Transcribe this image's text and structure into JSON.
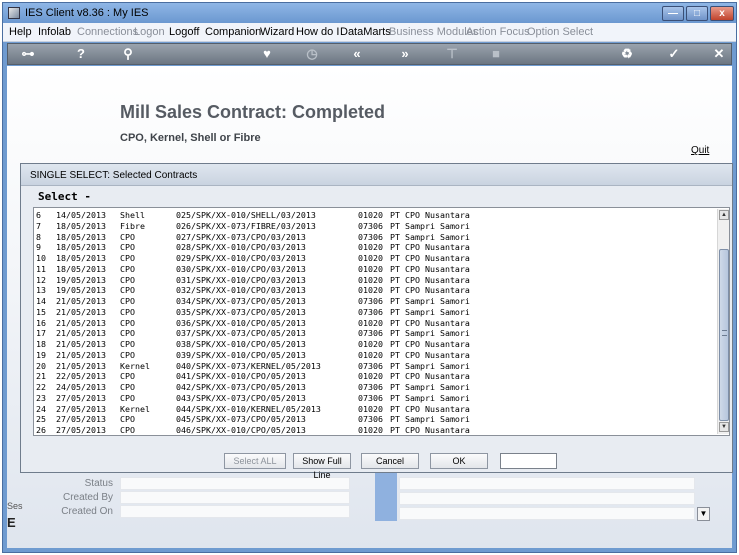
{
  "window": {
    "title": "IES Client v8.36 : My IES"
  },
  "window_controls": {
    "minimize": "—",
    "maximize": "□",
    "close": "x"
  },
  "menu": {
    "items": [
      {
        "label": "Help",
        "enabled": true
      },
      {
        "label": "Infolab",
        "enabled": true
      },
      {
        "label": "Connections",
        "enabled": false
      },
      {
        "label": "Logon",
        "enabled": false
      },
      {
        "label": "Logoff",
        "enabled": true
      },
      {
        "label": "Companion",
        "enabled": true
      },
      {
        "label": "Wizard",
        "enabled": true
      },
      {
        "label": "How do I",
        "enabled": true
      },
      {
        "label": "DataMarts",
        "enabled": true
      },
      {
        "label": "Business Modules",
        "enabled": false
      },
      {
        "label": "Action Focus",
        "enabled": false
      },
      {
        "label": "Option Select",
        "enabled": false
      }
    ]
  },
  "toolbar": {
    "icons": [
      {
        "name": "key-icon",
        "glyph": "⊶",
        "enabled": true
      },
      {
        "name": "help-icon",
        "glyph": "?",
        "enabled": true
      },
      {
        "name": "search-icon",
        "glyph": "⚲",
        "enabled": true
      },
      {
        "name": "favorite-icon",
        "glyph": "♥",
        "enabled": true
      },
      {
        "name": "clock-icon",
        "glyph": "◷",
        "enabled": false
      },
      {
        "name": "back-icon",
        "glyph": "«",
        "enabled": true
      },
      {
        "name": "forward-icon",
        "glyph": "»",
        "enabled": true
      },
      {
        "name": "tools-icon",
        "glyph": "⊤",
        "enabled": false
      },
      {
        "name": "stop-icon",
        "glyph": "■",
        "enabled": false
      },
      {
        "name": "recycle-icon",
        "glyph": "♻",
        "enabled": true
      },
      {
        "name": "ok-icon",
        "glyph": "✓",
        "enabled": true
      },
      {
        "name": "close-icon",
        "glyph": "✕",
        "enabled": true
      }
    ]
  },
  "page": {
    "title": "Mill Sales Contract: Completed",
    "subtitle": "CPO, Kernel, Shell or Fibre",
    "quit": "Quit"
  },
  "background_form": {
    "status_label": "Status",
    "created_by_label": "Created By",
    "created_on_label": "Created On",
    "side_fragment_1": "Ses",
    "side_fragment_2": "E"
  },
  "dialog": {
    "title": "SINGLE SELECT: Selected Contracts",
    "select_label": "Select -",
    "rows": [
      {
        "no": "6",
        "date": "14/05/2013",
        "type": "Shell",
        "ref": "025/SPK/XX-010/SHELL/03/2013",
        "code": "01020",
        "name": "PT CPO Nusantara"
      },
      {
        "no": "7",
        "date": "18/05/2013",
        "type": "Fibre",
        "ref": "026/SPK/XX-073/FIBRE/03/2013",
        "code": "07306",
        "name": "PT Sampri Samori"
      },
      {
        "no": "8",
        "date": "18/05/2013",
        "type": "CPO",
        "ref": "027/SPK/XX-073/CPO/03/2013",
        "code": "07306",
        "name": "PT Sampri Samori"
      },
      {
        "no": "9",
        "date": "18/05/2013",
        "type": "CPO",
        "ref": "028/SPK/XX-010/CPO/03/2013",
        "code": "01020",
        "name": "PT CPO Nusantara"
      },
      {
        "no": "10",
        "date": "18/05/2013",
        "type": "CPO",
        "ref": "029/SPK/XX-010/CPO/03/2013",
        "code": "01020",
        "name": "PT CPO Nusantara"
      },
      {
        "no": "11",
        "date": "18/05/2013",
        "type": "CPO",
        "ref": "030/SPK/XX-010/CPO/03/2013",
        "code": "01020",
        "name": "PT CPO Nusantara"
      },
      {
        "no": "12",
        "date": "19/05/2013",
        "type": "CPO",
        "ref": "031/SPK/XX-010/CPO/03/2013",
        "code": "01020",
        "name": "PT CPO Nusantara"
      },
      {
        "no": "13",
        "date": "19/05/2013",
        "type": "CPO",
        "ref": "032/SPK/XX-010/CPO/03/2013",
        "code": "01020",
        "name": "PT CPO Nusantara"
      },
      {
        "no": "14",
        "date": "21/05/2013",
        "type": "CPO",
        "ref": "034/SPK/XX-073/CPO/05/2013",
        "code": "07306",
        "name": "PT Sampri Samori"
      },
      {
        "no": "15",
        "date": "21/05/2013",
        "type": "CPO",
        "ref": "035/SPK/XX-073/CPO/05/2013",
        "code": "07306",
        "name": "PT Sampri Samori"
      },
      {
        "no": "16",
        "date": "21/05/2013",
        "type": "CPO",
        "ref": "036/SPK/XX-010/CPO/05/2013",
        "code": "01020",
        "name": "PT CPO Nusantara"
      },
      {
        "no": "17",
        "date": "21/05/2013",
        "type": "CPO",
        "ref": "037/SPK/XX-073/CPO/05/2013",
        "code": "07306",
        "name": "PT Sampri Samori"
      },
      {
        "no": "18",
        "date": "21/05/2013",
        "type": "CPO",
        "ref": "038/SPK/XX-010/CPO/05/2013",
        "code": "01020",
        "name": "PT CPO Nusantara"
      },
      {
        "no": "19",
        "date": "21/05/2013",
        "type": "CPO",
        "ref": "039/SPK/XX-010/CPO/05/2013",
        "code": "01020",
        "name": "PT CPO Nusantara"
      },
      {
        "no": "20",
        "date": "21/05/2013",
        "type": "Kernel",
        "ref": "040/SPK/XX-073/KERNEL/05/2013",
        "code": "07306",
        "name": "PT Sampri Samori"
      },
      {
        "no": "21",
        "date": "22/05/2013",
        "type": "CPO",
        "ref": "041/SPK/XX-010/CPO/05/2013",
        "code": "01020",
        "name": "PT CPO Nusantara"
      },
      {
        "no": "22",
        "date": "24/05/2013",
        "type": "CPO",
        "ref": "042/SPK/XX-073/CPO/05/2013",
        "code": "07306",
        "name": "PT Sampri Samori"
      },
      {
        "no": "23",
        "date": "27/05/2013",
        "type": "CPO",
        "ref": "043/SPK/XX-073/CPO/05/2013",
        "code": "07306",
        "name": "PT Sampri Samori"
      },
      {
        "no": "24",
        "date": "27/05/2013",
        "type": "Kernel",
        "ref": "044/SPK/XX-010/KERNEL/05/2013",
        "code": "01020",
        "name": "PT CPO Nusantara"
      },
      {
        "no": "25",
        "date": "27/05/2013",
        "type": "CPO",
        "ref": "045/SPK/XX-073/CPO/05/2013",
        "code": "07306",
        "name": "PT Sampri Samori"
      },
      {
        "no": "26",
        "date": "27/05/2013",
        "type": "CPO",
        "ref": "046/SPK/XX-010/CPO/05/2013",
        "code": "01020",
        "name": "PT CPO Nusantara"
      }
    ],
    "buttons": {
      "select_all": "Select ALL",
      "show_full_line": "Show Full Line",
      "cancel": "Cancel",
      "ok": "OK"
    },
    "input_value": ""
  }
}
